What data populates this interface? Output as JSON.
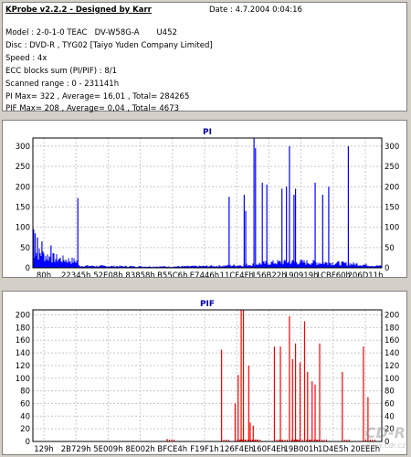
{
  "info": {
    "title": "KProbe v2.2.2 - Designed by Karr",
    "date": "Date : 4.7.2004 0:04:16",
    "lines": [
      "Model : 2-0-1-0 TEAC   DV-W58G-A       U452",
      "Disc : DVD-R , TYG02 [Taiyo Yuden Company Limited]",
      "Speed : 4x",
      "ECC blocks sum (PI/PIF) : 8/1",
      "Scanned range : 0 - 231141h",
      "PI Max= 322 , Average= 16,01 , Total= 284265",
      "PIF Max= 208 , Average= 0,04 , Total= 4673"
    ]
  },
  "watermark": {
    "logo": "CD-R",
    "url": "www.cdr.cz"
  },
  "chart_data": [
    {
      "type": "bar",
      "title": "PI",
      "color": "#0000ff",
      "ylim": [
        0,
        320
      ],
      "yticks": [
        0,
        50,
        100,
        150,
        200,
        250,
        300
      ],
      "xlim": [
        0,
        231141
      ],
      "xtick_labels": [
        "80h",
        "22345h",
        "52E08h",
        "83858h",
        "B55C6h",
        "E7446h",
        "11CF4Fh",
        "156B22h",
        "190919h",
        "1CBF60h",
        "206D11h"
      ],
      "baseline": [
        [
          0,
          60
        ],
        [
          2000,
          55
        ],
        [
          5000,
          45
        ],
        [
          10000,
          38
        ],
        [
          15000,
          32
        ],
        [
          20000,
          28
        ],
        [
          26000,
          24
        ],
        [
          29500,
          22
        ],
        [
          30000,
          7
        ],
        [
          40000,
          6
        ],
        [
          60000,
          5
        ],
        [
          90000,
          4
        ],
        [
          120000,
          6
        ],
        [
          140000,
          9
        ],
        [
          150000,
          14
        ],
        [
          160000,
          18
        ],
        [
          172000,
          20
        ],
        [
          185000,
          18
        ],
        [
          200000,
          16
        ],
        [
          215000,
          12
        ],
        [
          225000,
          8
        ],
        [
          231141,
          6
        ]
      ],
      "spikes": [
        [
          500,
          95
        ],
        [
          1500,
          85
        ],
        [
          3000,
          75
        ],
        [
          6000,
          65
        ],
        [
          12000,
          55
        ],
        [
          29800,
          172
        ],
        [
          130000,
          175
        ],
        [
          140000,
          180
        ],
        [
          141000,
          140
        ],
        [
          146500,
          322
        ],
        [
          147500,
          295
        ],
        [
          152000,
          210
        ],
        [
          155000,
          205
        ],
        [
          165000,
          195
        ],
        [
          168000,
          200
        ],
        [
          170000,
          300
        ],
        [
          173000,
          180
        ],
        [
          174000,
          195
        ],
        [
          187000,
          210
        ],
        [
          192000,
          180
        ],
        [
          196000,
          200
        ],
        [
          209000,
          300
        ]
      ]
    },
    {
      "type": "bar",
      "title": "PIF",
      "color": "#ff0000",
      "ylim": [
        0,
        208
      ],
      "yticks": [
        0,
        20,
        40,
        60,
        80,
        100,
        120,
        140,
        160,
        180,
        200
      ],
      "xlim": [
        0,
        231141
      ],
      "xtick_labels": [
        "129h",
        "2B729h",
        "5E009h",
        "8E002h",
        "BFCE4h",
        "F19F1h",
        "126F4Eh",
        "160F4Eh",
        "19B001h",
        "1D4E5h",
        "20EEEh"
      ],
      "spikes": [
        [
          89000,
          4
        ],
        [
          125000,
          145
        ],
        [
          134000,
          60
        ],
        [
          136000,
          105
        ],
        [
          138000,
          208
        ],
        [
          139500,
          208
        ],
        [
          143000,
          120
        ],
        [
          144000,
          30
        ],
        [
          146000,
          25
        ],
        [
          160000,
          150
        ],
        [
          164000,
          150
        ],
        [
          170000,
          198
        ],
        [
          172000,
          130
        ],
        [
          174000,
          155
        ],
        [
          177000,
          125
        ],
        [
          180000,
          190
        ],
        [
          182000,
          110
        ],
        [
          185000,
          95
        ],
        [
          187000,
          90
        ],
        [
          190000,
          155
        ],
        [
          205000,
          110
        ],
        [
          219000,
          150
        ],
        [
          222000,
          70
        ]
      ]
    }
  ]
}
